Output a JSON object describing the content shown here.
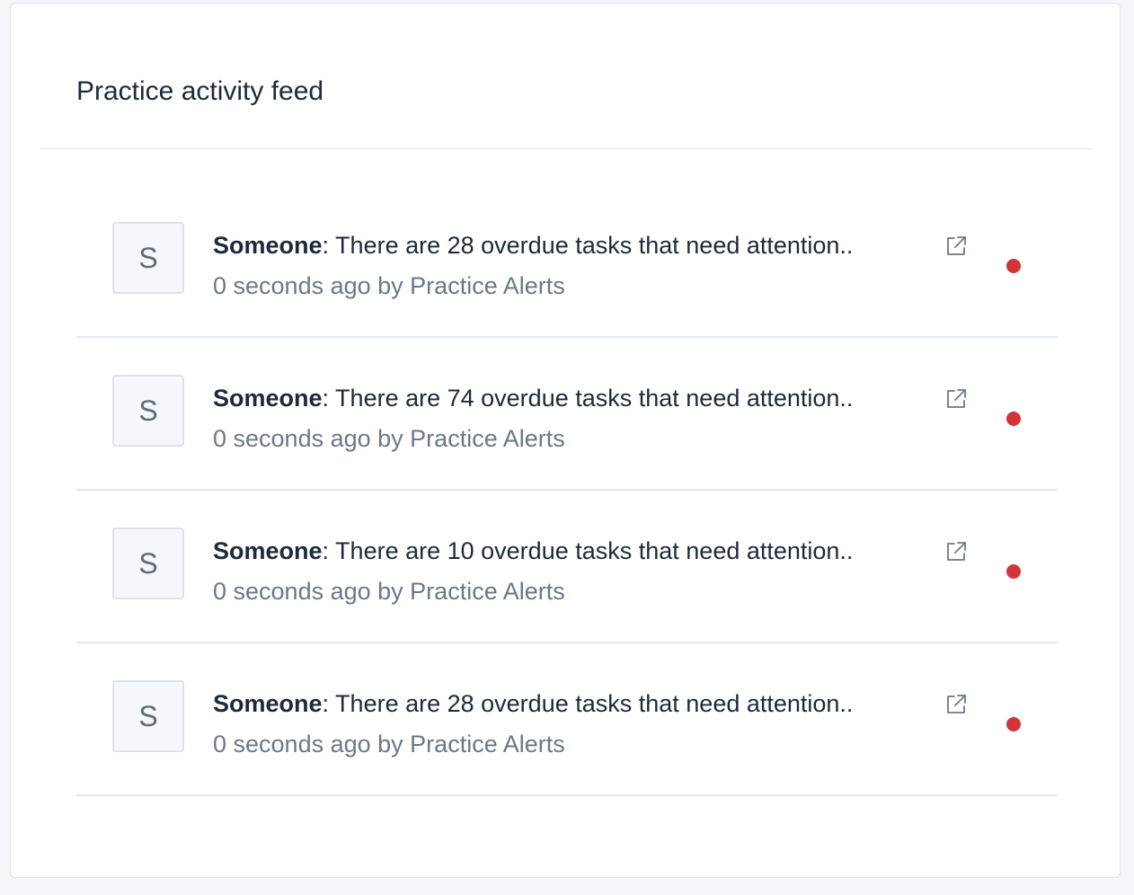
{
  "feed": {
    "title": "Practice activity feed",
    "items": [
      {
        "avatar": "S",
        "author": "Someone",
        "separator": ":",
        "message": " There are 28 overdue tasks that need attention..",
        "time": "0 seconds ago",
        "by_word": " by ",
        "source": "Practice Alerts",
        "link_icon": "external-link-icon",
        "unread": true
      },
      {
        "avatar": "S",
        "author": "Someone",
        "separator": ":",
        "message": " There are 74 overdue tasks that need attention..",
        "time": "0 seconds ago",
        "by_word": " by ",
        "source": "Practice Alerts",
        "link_icon": "external-link-icon",
        "unread": true
      },
      {
        "avatar": "S",
        "author": "Someone",
        "separator": ":",
        "message": " There are 10 overdue tasks that need attention..",
        "time": "0 seconds ago",
        "by_word": " by ",
        "source": "Practice Alerts",
        "link_icon": "external-link-icon",
        "unread": true
      },
      {
        "avatar": "S",
        "author": "Someone",
        "separator": ":",
        "message": " There are 28 overdue tasks that need attention..",
        "time": "0 seconds ago",
        "by_word": " by ",
        "source": "Practice Alerts",
        "link_icon": "external-link-icon",
        "unread": true
      }
    ]
  },
  "colors": {
    "page_background": "#f5f6f9",
    "card_background": "#ffffff",
    "text_primary": "#1e2a3a",
    "text_secondary": "#6b7888",
    "divider": "#e3e6eb",
    "unread_dot": "#d33437"
  }
}
